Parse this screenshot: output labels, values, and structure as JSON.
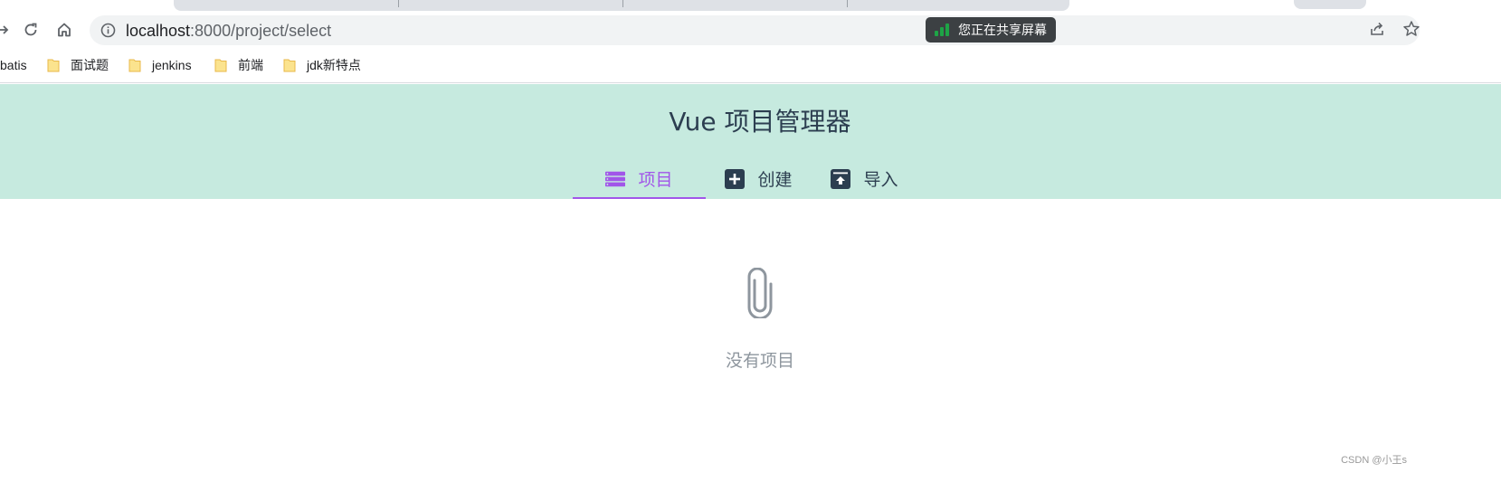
{
  "browser": {
    "address_bar": {
      "host": "localhost",
      "path": ":8000/project/select"
    },
    "screen_share_banner": "您正在共享屏幕",
    "bookmarks": [
      {
        "label": "batis"
      },
      {
        "label": "面试题"
      },
      {
        "label": "jenkins"
      },
      {
        "label": "前端"
      },
      {
        "label": "jdk新特点"
      }
    ]
  },
  "app": {
    "title": "Vue 项目管理器",
    "tabs": [
      {
        "label": "项目",
        "icon": "list-icon",
        "active": true
      },
      {
        "label": "创建",
        "icon": "plus-square-icon",
        "active": false
      },
      {
        "label": "导入",
        "icon": "upload-box-icon",
        "active": false
      }
    ],
    "empty_state": {
      "icon": "paperclip-icon",
      "text": "没有项目"
    },
    "colors": {
      "header_bg": "#c6eadf",
      "accent": "#a155e9",
      "text": "#2c3e50",
      "muted": "#8e969e"
    }
  },
  "watermark": "CSDN @小王s"
}
